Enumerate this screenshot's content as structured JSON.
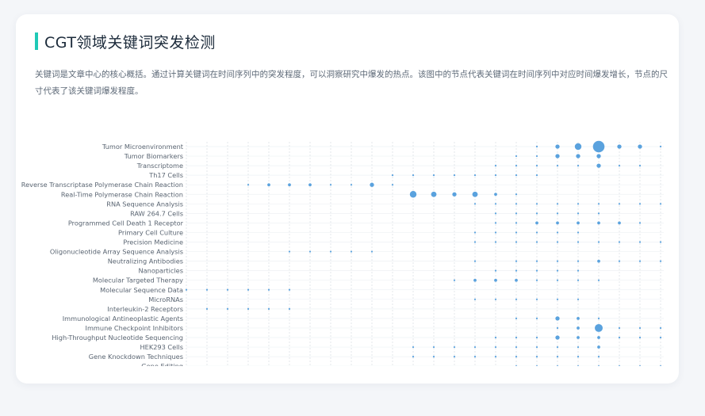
{
  "header": {
    "title": "CGT领域关键词突发检测",
    "description": "关键词是文章中心的核心概括。通过计算关键词在时间序列中的突发程度，可以洞察研究中爆发的热点。该图中的节点代表关键词在时间序列中对应时间爆发增长，节点的尺寸代表了该关键词爆发程度。"
  },
  "chart_data": {
    "type": "scatter",
    "title": "",
    "xlabel": "",
    "ylabel": "",
    "x_count": 24,
    "grid": true,
    "color": "#5aa2de",
    "keywords": [
      "Tumor Microenvironment",
      "Tumor Biomarkers",
      "Transcriptome",
      "Th17 Cells",
      "Reverse Transcriptase Polymerase Chain Reaction",
      "Real-Time Polymerase Chain Reaction",
      "RNA Sequence Analysis",
      "RAW 264.7 Cells",
      "Programmed Cell Death 1 Receptor",
      "Primary Cell Culture",
      "Precision Medicine",
      "Oligonucleotide Array Sequence Analysis",
      "Neutralizing Antibodies",
      "Nanoparticles",
      "Molecular Targeted Therapy",
      "Molecular Sequence Data",
      "MicroRNAs",
      "Interleukin-2 Receptors",
      "Immunological Antineoplastic Agents",
      "Immune Checkpoint Inhibitors",
      "High-Throughput Nucleotide Sequencing",
      "HEK293 Cells",
      "Gene Knockdown Techniques",
      "Gene Editing"
    ],
    "points": [
      [
        0,
        17,
        1
      ],
      [
        0,
        18,
        2
      ],
      [
        0,
        19,
        3
      ],
      [
        0,
        20,
        5
      ],
      [
        0,
        21,
        2
      ],
      [
        0,
        22,
        2
      ],
      [
        0,
        23,
        1
      ],
      [
        1,
        16,
        1
      ],
      [
        1,
        17,
        1
      ],
      [
        1,
        18,
        2
      ],
      [
        1,
        19,
        2
      ],
      [
        1,
        20,
        2
      ],
      [
        2,
        15,
        1
      ],
      [
        2,
        16,
        1
      ],
      [
        2,
        17,
        1
      ],
      [
        2,
        18,
        1
      ],
      [
        2,
        19,
        1
      ],
      [
        2,
        20,
        2
      ],
      [
        2,
        21,
        1
      ],
      [
        2,
        22,
        1
      ],
      [
        3,
        10,
        1
      ],
      [
        3,
        11,
        1
      ],
      [
        3,
        12,
        1
      ],
      [
        3,
        13,
        1
      ],
      [
        3,
        14,
        1
      ],
      [
        3,
        15,
        1
      ],
      [
        3,
        16,
        1
      ],
      [
        3,
        17,
        1
      ],
      [
        4,
        3,
        1
      ],
      [
        4,
        4,
        1.5
      ],
      [
        4,
        5,
        1.5
      ],
      [
        4,
        6,
        1.5
      ],
      [
        4,
        7,
        1
      ],
      [
        4,
        8,
        1
      ],
      [
        4,
        9,
        2
      ],
      [
        4,
        10,
        1
      ],
      [
        5,
        11,
        3
      ],
      [
        5,
        12,
        2.5
      ],
      [
        5,
        13,
        2
      ],
      [
        5,
        14,
        2.5
      ],
      [
        5,
        15,
        1.5
      ],
      [
        5,
        16,
        1
      ],
      [
        6,
        14,
        1
      ],
      [
        6,
        15,
        1
      ],
      [
        6,
        16,
        1
      ],
      [
        6,
        17,
        1
      ],
      [
        6,
        18,
        1
      ],
      [
        6,
        19,
        1
      ],
      [
        6,
        20,
        1
      ],
      [
        6,
        21,
        1
      ],
      [
        6,
        22,
        1
      ],
      [
        6,
        23,
        1
      ],
      [
        7,
        15,
        1
      ],
      [
        7,
        16,
        1
      ],
      [
        7,
        17,
        1
      ],
      [
        7,
        18,
        1
      ],
      [
        7,
        19,
        1
      ],
      [
        7,
        20,
        1
      ],
      [
        8,
        15,
        1
      ],
      [
        8,
        16,
        1
      ],
      [
        8,
        17,
        1.5
      ],
      [
        8,
        18,
        1.5
      ],
      [
        8,
        19,
        1.5
      ],
      [
        8,
        20,
        1.5
      ],
      [
        8,
        21,
        1.5
      ],
      [
        8,
        22,
        1
      ],
      [
        9,
        14,
        1
      ],
      [
        9,
        15,
        1
      ],
      [
        9,
        16,
        1
      ],
      [
        9,
        17,
        1
      ],
      [
        9,
        18,
        1
      ],
      [
        9,
        19,
        1
      ],
      [
        10,
        14,
        1
      ],
      [
        10,
        15,
        1
      ],
      [
        10,
        16,
        1
      ],
      [
        10,
        17,
        1
      ],
      [
        10,
        18,
        1
      ],
      [
        10,
        19,
        1
      ],
      [
        10,
        20,
        1
      ],
      [
        10,
        21,
        1
      ],
      [
        10,
        22,
        1
      ],
      [
        10,
        23,
        1
      ],
      [
        11,
        5,
        1
      ],
      [
        11,
        6,
        1
      ],
      [
        11,
        7,
        1
      ],
      [
        11,
        8,
        1
      ],
      [
        11,
        9,
        1
      ],
      [
        12,
        14,
        1
      ],
      [
        12,
        16,
        1
      ],
      [
        12,
        17,
        1
      ],
      [
        12,
        18,
        1
      ],
      [
        12,
        19,
        1
      ],
      [
        12,
        20,
        1.5
      ],
      [
        12,
        21,
        1
      ],
      [
        12,
        22,
        1
      ],
      [
        12,
        23,
        1
      ],
      [
        13,
        15,
        1
      ],
      [
        13,
        16,
        1
      ],
      [
        13,
        17,
        1
      ],
      [
        13,
        18,
        1
      ],
      [
        13,
        19,
        1
      ],
      [
        14,
        13,
        1
      ],
      [
        14,
        14,
        1.5
      ],
      [
        14,
        15,
        1.5
      ],
      [
        14,
        16,
        1.5
      ],
      [
        14,
        17,
        1
      ],
      [
        14,
        18,
        1
      ],
      [
        14,
        19,
        1
      ],
      [
        14,
        20,
        1
      ],
      [
        15,
        0,
        1
      ],
      [
        15,
        1,
        1
      ],
      [
        15,
        2,
        1
      ],
      [
        15,
        3,
        1
      ],
      [
        15,
        4,
        1
      ],
      [
        15,
        5,
        1
      ],
      [
        16,
        14,
        1
      ],
      [
        16,
        15,
        1
      ],
      [
        16,
        16,
        1
      ],
      [
        16,
        17,
        1
      ],
      [
        16,
        18,
        1
      ],
      [
        16,
        19,
        1
      ],
      [
        17,
        1,
        1
      ],
      [
        17,
        2,
        1
      ],
      [
        17,
        3,
        1
      ],
      [
        17,
        4,
        1
      ],
      [
        17,
        5,
        1
      ],
      [
        18,
        16,
        1
      ],
      [
        18,
        17,
        1
      ],
      [
        18,
        18,
        2
      ],
      [
        18,
        19,
        1.5
      ],
      [
        18,
        20,
        1
      ],
      [
        19,
        18,
        1
      ],
      [
        19,
        19,
        1.5
      ],
      [
        19,
        20,
        3.5
      ],
      [
        19,
        21,
        1
      ],
      [
        19,
        22,
        1
      ],
      [
        19,
        23,
        1
      ],
      [
        20,
        15,
        1
      ],
      [
        20,
        16,
        1
      ],
      [
        20,
        17,
        1
      ],
      [
        20,
        18,
        2
      ],
      [
        20,
        19,
        1.5
      ],
      [
        20,
        20,
        1.5
      ],
      [
        20,
        21,
        1
      ],
      [
        20,
        22,
        1
      ],
      [
        20,
        23,
        1
      ],
      [
        21,
        11,
        1
      ],
      [
        21,
        12,
        1
      ],
      [
        21,
        13,
        1
      ],
      [
        21,
        14,
        1
      ],
      [
        21,
        15,
        1
      ],
      [
        21,
        16,
        1
      ],
      [
        21,
        17,
        1
      ],
      [
        21,
        18,
        1
      ],
      [
        21,
        19,
        1
      ],
      [
        21,
        20,
        1.5
      ],
      [
        22,
        11,
        1
      ],
      [
        22,
        12,
        1
      ],
      [
        22,
        13,
        1
      ],
      [
        22,
        14,
        1
      ],
      [
        22,
        15,
        1
      ],
      [
        22,
        16,
        1
      ],
      [
        22,
        17,
        1
      ],
      [
        22,
        18,
        1
      ],
      [
        22,
        19,
        1
      ],
      [
        22,
        20,
        1
      ],
      [
        23,
        16,
        1
      ],
      [
        23,
        17,
        1
      ],
      [
        23,
        18,
        1
      ],
      [
        23,
        19,
        1
      ],
      [
        23,
        20,
        1
      ],
      [
        23,
        21,
        1
      ],
      [
        23,
        22,
        1
      ],
      [
        23,
        23,
        1
      ]
    ]
  }
}
